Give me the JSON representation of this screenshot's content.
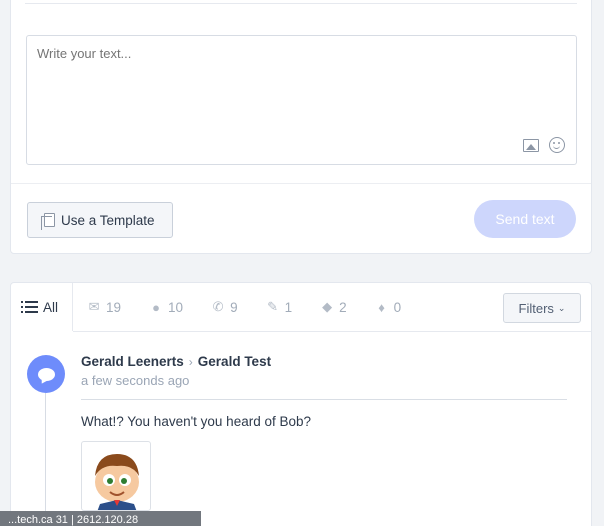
{
  "composer": {
    "placeholder": "Write your text...",
    "template_label": "Use a Template",
    "send_label": "Send text"
  },
  "feed": {
    "tabs": [
      {
        "label": "All",
        "icon": "list-icon",
        "active": true
      },
      {
        "label": "19",
        "icon": "email-icon"
      },
      {
        "label": "10",
        "icon": "comment-icon"
      },
      {
        "label": "9",
        "icon": "phone-icon"
      },
      {
        "label": "1",
        "icon": "pin-icon"
      },
      {
        "label": "2",
        "icon": "chat-icon"
      },
      {
        "label": "0",
        "icon": "drop-icon"
      }
    ],
    "filters_label": "Filters",
    "message": {
      "sender": "Gerald Leenerts",
      "recipient": "Gerald Test",
      "time": "a few seconds ago",
      "body": "What!? You haven't you heard of Bob?"
    }
  },
  "status_tooltip": "...tech.ca  31 | 2612.120.28",
  "colors": {
    "accent": "#6e8cfb",
    "send_disabled": "#cdd6fc"
  }
}
